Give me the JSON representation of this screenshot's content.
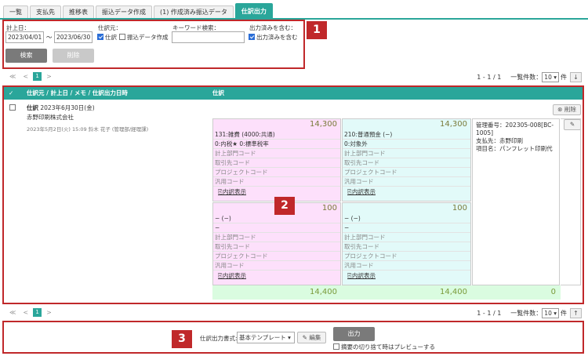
{
  "tabs": [
    {
      "label": "一覧"
    },
    {
      "label": "支払先"
    },
    {
      "label": "推移表"
    },
    {
      "label": "振込データ作成"
    },
    {
      "label": "(1) 作成済み振込データ"
    },
    {
      "label": "仕訳出力"
    }
  ],
  "filter": {
    "date_label": "計上日：",
    "date_from": "2023/04/01",
    "date_sep": "〜",
    "date_to": "2023/06/30",
    "source_label": "仕訳元：",
    "source_opt1": "仕訳",
    "source_opt2": "振込データ作成",
    "keyword_label": "キーワード検索：",
    "keyword_value": "",
    "include_label": "出力済みを含む：",
    "include_opt": "出力済みを含む",
    "search_btn": "検索",
    "clear_btn": "削除",
    "badge": "1"
  },
  "pager": {
    "first": "≪",
    "prev": "<",
    "page": "1",
    "next": ">",
    "range": "1 - 1 / 1",
    "per_page_label": "一覧件数：",
    "per_page": "10",
    "unit": "件"
  },
  "table": {
    "head_check": "✓",
    "head_col1": "仕訳元 / 計上日 / メモ / 仕訳出力日時",
    "head_col2": "仕訳",
    "badge": "2",
    "row": {
      "title_prefix": "仕訳",
      "title_date": "2023年6月30日(金)",
      "company": "赤野印刷株式会社",
      "meta": "2023年5月2日(火) 15:09 鈴木 花子 (管理部/経理課)",
      "delete_btn": "削除",
      "note": "管理番号：202305-008[BC-1005]\n支払先：赤野印刷\n項目名：パンフレット印刷代"
    },
    "debit1": {
      "amount": "14,300",
      "account": "131:雑費 (4000:共通)",
      "tax": "0:内税★ 0:標準税率",
      "dept": "計上部門コード",
      "partner": "取引先コード",
      "project": "プロジェクトコード",
      "general": "汎用コード",
      "detail": "内訳表示"
    },
    "credit1": {
      "amount": "14,300",
      "account": "210:普通預金 (−)",
      "tax": "0:対象外",
      "dept": "計上部門コード",
      "partner": "取引先コード",
      "project": "プロジェクトコード",
      "general": "汎用コード",
      "detail": "内訳表示"
    },
    "debit2": {
      "amount": "100",
      "account": "− (−)",
      "tax": "−",
      "dept": "計上部門コード",
      "partner": "取引先コード",
      "project": "プロジェクトコード",
      "general": "汎用コード",
      "detail": "内訳表示"
    },
    "credit2": {
      "amount": "100",
      "account": "− (−)",
      "tax": "−",
      "dept": "計上部門コード",
      "partner": "取引先コード",
      "project": "プロジェクトコード",
      "general": "汎用コード",
      "detail": "内訳表示"
    },
    "totals": {
      "debit": "14,400",
      "credit": "14,400",
      "diff": "0"
    }
  },
  "output": {
    "badge": "3",
    "format_label": "仕訳出力書式:",
    "format_value": "基本テンプレート",
    "edit_btn": "編集",
    "output_btn": "出力",
    "preview_label": "摘要の切り捨て時はプレビューする"
  },
  "colors": {
    "accent": "#2aa69a",
    "highlight": "#c0282a",
    "debit_bg": "#fde0fb",
    "credit_bg": "#e2faf9"
  }
}
